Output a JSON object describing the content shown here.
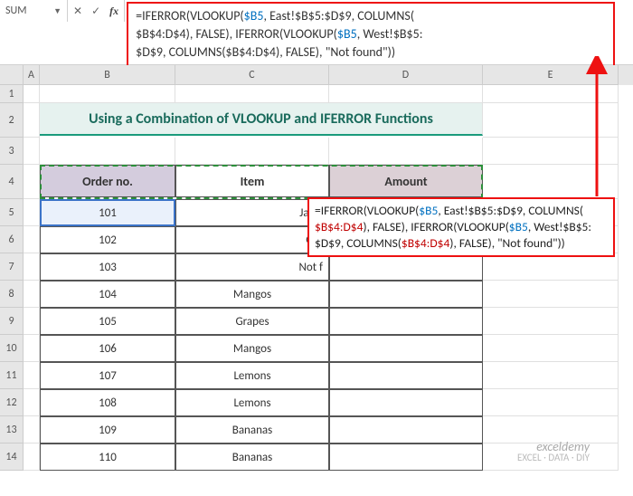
{
  "nameBox": "SUM",
  "formulaBar": {
    "line1_a": "=IFERROR(VLOOKUP(",
    "line1_b": "$B5",
    "line1_c": ", East!$B$5:$D$9, COLUMNS(",
    "line2_a": "$B$4:D$4), FALSE), IFERROR(VLOOKUP(",
    "line2_b": "$B5",
    "line2_c": ", West!$B$5:",
    "line3": "$D$9, COLUMNS($B$4:D$4), FALSE), \"Not found\"))"
  },
  "title": "Using a Combination of VLOOKUP and IFERROR Functions",
  "headers": {
    "b": "Order no.",
    "c": "Item",
    "d": "Amount"
  },
  "rows": [
    {
      "order": "101",
      "item": "Jackf"
    },
    {
      "order": "102",
      "item": "Gra"
    },
    {
      "order": "103",
      "item": "Not f"
    },
    {
      "order": "104",
      "item": "Mangos"
    },
    {
      "order": "105",
      "item": "Grapes"
    },
    {
      "order": "106",
      "item": "Mangos"
    },
    {
      "order": "107",
      "item": "Lemons"
    },
    {
      "order": "108",
      "item": "Lemons"
    },
    {
      "order": "109",
      "item": "Bananas"
    },
    {
      "order": "110",
      "item": "Bananas"
    }
  ],
  "tooltip": {
    "t1a": "=IFERROR(VLOOKUP(",
    "t1b": "$B5",
    "t1c": ", East!$B$5:$D$9, COLUMNS(",
    "t2a": "$B$4:D$4",
    "t2b": "), FALSE), IFERROR(VLOOKUP(",
    "t2c": "$B5",
    "t2d": ", West!$B$5:",
    "t3a": "$D$9, COLUMNS(",
    "t3b": "$B$4:D$4",
    "t3c": "), FALSE), \"Not found\"))"
  },
  "cols": [
    "A",
    "B",
    "C",
    "D",
    "E"
  ],
  "rownums": [
    "1",
    "2",
    "3",
    "4",
    "5",
    "6",
    "7",
    "8",
    "9",
    "10",
    "11",
    "12",
    "13",
    "14"
  ],
  "watermark": {
    "brand": "exceldemy",
    "tag": "EXCEL · DATA · DIY"
  }
}
